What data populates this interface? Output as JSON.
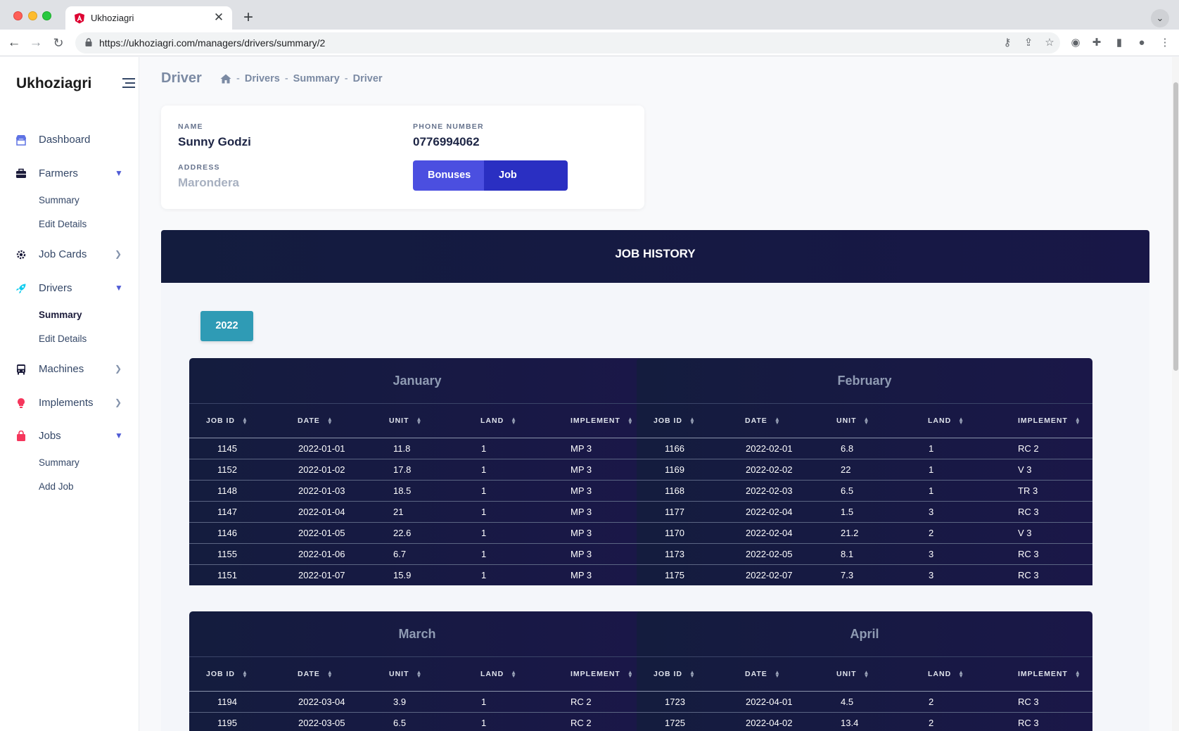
{
  "browser": {
    "tab_title": "Ukhoziagri",
    "new_tab_symbol": "+",
    "close_symbol": "✕",
    "url": "https://ukhoziagri.com/managers/drivers/summary/2"
  },
  "sidebar": {
    "brand": "Ukhoziagri",
    "items": [
      {
        "label": "Dashboard"
      },
      {
        "label": "Farmers",
        "sub": [
          "Summary",
          "Edit Details"
        ]
      },
      {
        "label": "Job Cards"
      },
      {
        "label": "Drivers",
        "sub": [
          "Summary",
          "Edit Details"
        ]
      },
      {
        "label": "Machines"
      },
      {
        "label": "Implements"
      },
      {
        "label": "Jobs",
        "sub": [
          "Summary",
          "Add Job"
        ]
      }
    ],
    "active_sub": "Drivers > Summary"
  },
  "page": {
    "title": "Driver",
    "breadcrumbs": [
      "Drivers",
      "Summary",
      "Driver"
    ],
    "separator": "-"
  },
  "profile": {
    "name_label": "NAME",
    "name": "Sunny Godzi",
    "address_label": "ADDRESS",
    "address": "Marondera",
    "phone_label": "PHONE NUMBER",
    "phone": "0776994062",
    "bonuses_button": "Bonuses",
    "job_history_button": "Job History"
  },
  "job_history": {
    "title": "JOB HISTORY",
    "year": "2022",
    "columns": [
      "JOB ID",
      "DATE",
      "UNIT",
      "LAND",
      "IMPLEMENT"
    ],
    "months": [
      {
        "name": "January",
        "rows": [
          [
            "1145",
            "2022-01-01",
            "11.8",
            "1",
            "MP 3"
          ],
          [
            "1152",
            "2022-01-02",
            "17.8",
            "1",
            "MP 3"
          ],
          [
            "1148",
            "2022-01-03",
            "18.5",
            "1",
            "MP 3"
          ],
          [
            "1147",
            "2022-01-04",
            "21",
            "1",
            "MP 3"
          ],
          [
            "1146",
            "2022-01-05",
            "22.6",
            "1",
            "MP 3"
          ],
          [
            "1155",
            "2022-01-06",
            "6.7",
            "1",
            "MP 3"
          ],
          [
            "1151",
            "2022-01-07",
            "15.9",
            "1",
            "MP 3"
          ]
        ]
      },
      {
        "name": "February",
        "rows": [
          [
            "1166",
            "2022-02-01",
            "6.8",
            "1",
            "RC 2"
          ],
          [
            "1169",
            "2022-02-02",
            "22",
            "1",
            "V 3"
          ],
          [
            "1168",
            "2022-02-03",
            "6.5",
            "1",
            "TR 3"
          ],
          [
            "1177",
            "2022-02-04",
            "1.5",
            "3",
            "RC 3"
          ],
          [
            "1170",
            "2022-02-04",
            "21.2",
            "2",
            "V 3"
          ],
          [
            "1173",
            "2022-02-05",
            "8.1",
            "3",
            "RC 3"
          ],
          [
            "1175",
            "2022-02-07",
            "7.3",
            "3",
            "RC 3"
          ]
        ]
      },
      {
        "name": "March",
        "rows": [
          [
            "1194",
            "2022-03-04",
            "3.9",
            "1",
            "RC 2"
          ],
          [
            "1195",
            "2022-03-05",
            "6.5",
            "1",
            "RC 2"
          ]
        ]
      },
      {
        "name": "April",
        "rows": [
          [
            "1723",
            "2022-04-01",
            "4.5",
            "2",
            "RC 3"
          ],
          [
            "1725",
            "2022-04-02",
            "13.4",
            "2",
            "RC 3"
          ]
        ]
      }
    ]
  },
  "colors": {
    "primary_button": "#4b4fe0",
    "active_button": "#2a2fc2",
    "year_button": "#2f9bb5",
    "table_bg": "#141c3e"
  }
}
